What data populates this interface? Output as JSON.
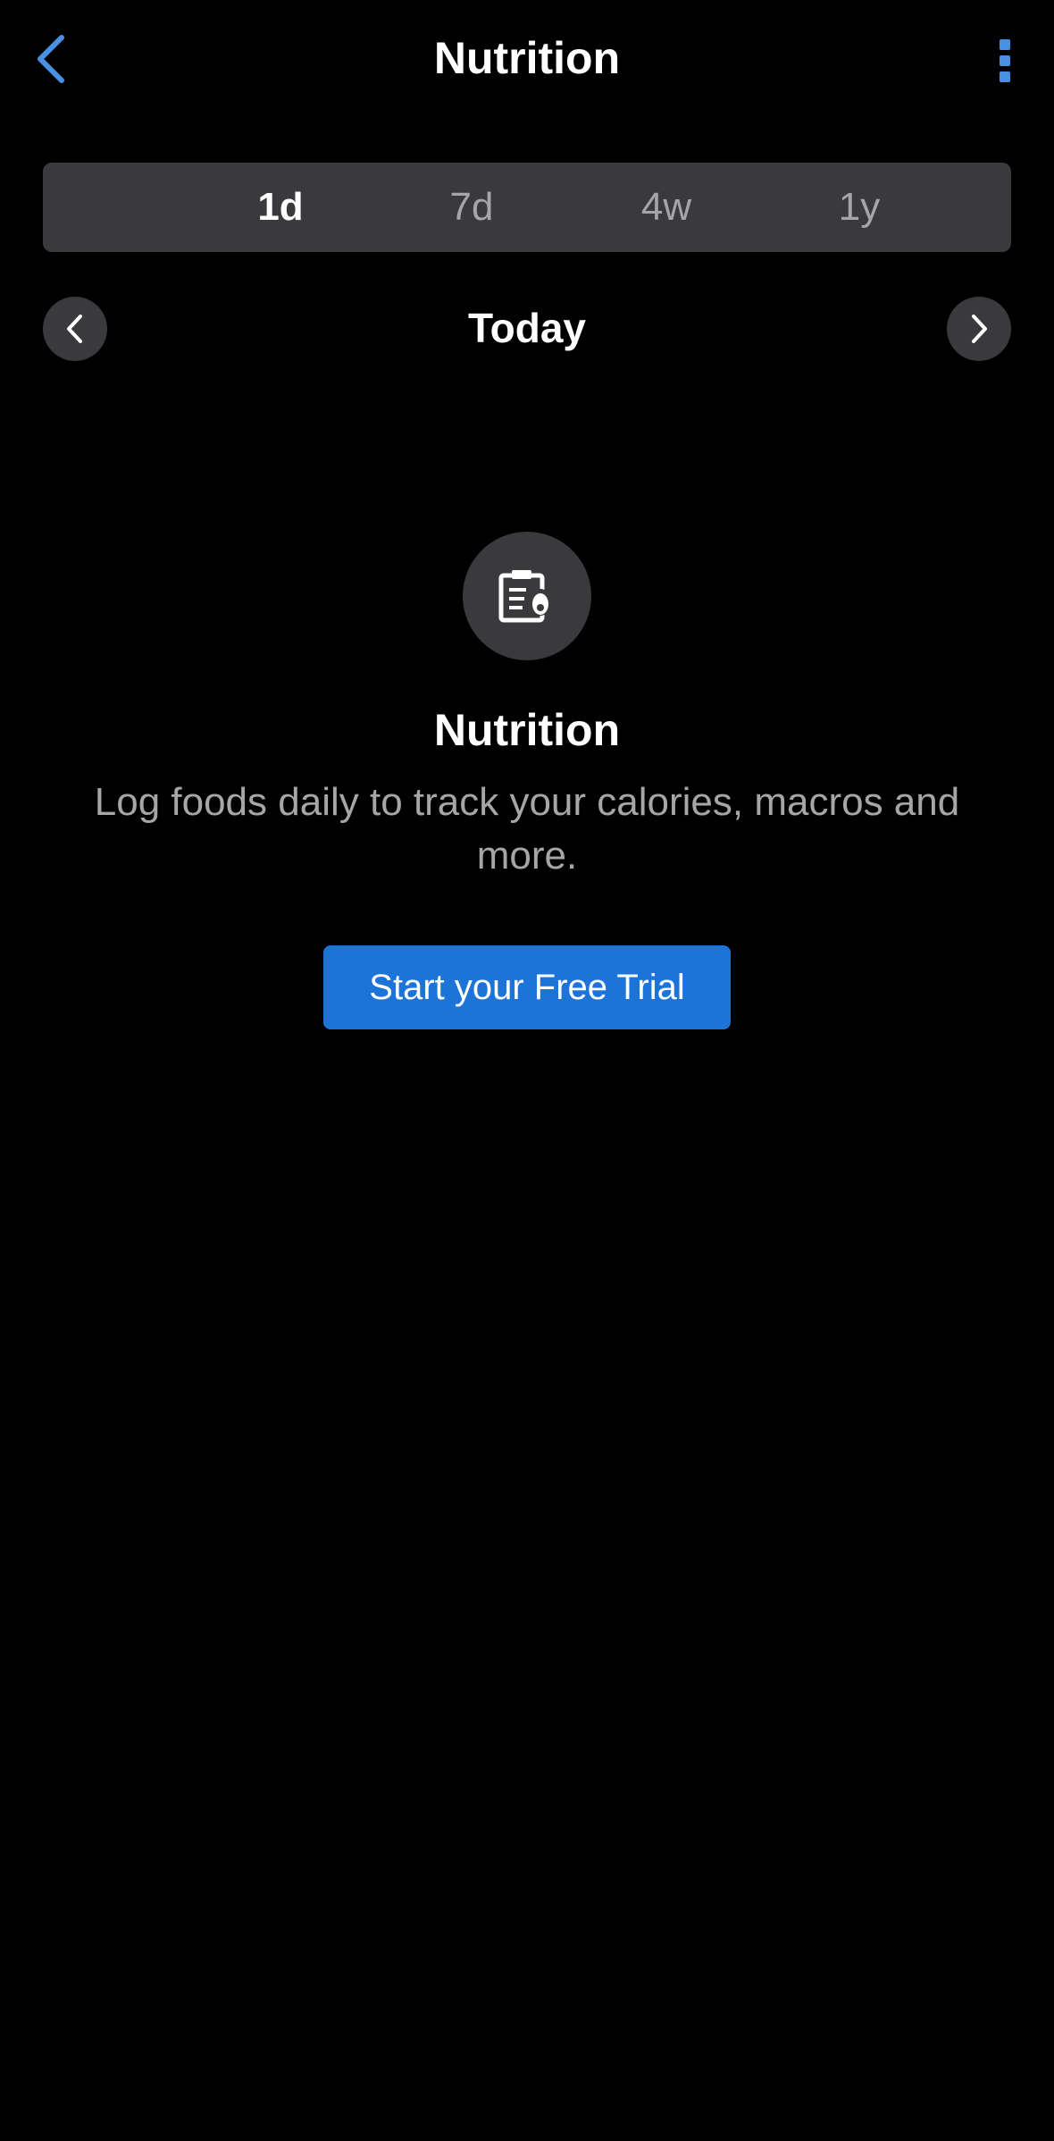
{
  "header": {
    "title": "Nutrition",
    "back_icon": "chevron-left-icon",
    "more_icon": "vertical-dots-icon"
  },
  "range_tabs": [
    {
      "label": "1d",
      "selected": true
    },
    {
      "label": "7d",
      "selected": false
    },
    {
      "label": "4w",
      "selected": false
    },
    {
      "label": "1y",
      "selected": false
    }
  ],
  "date_nav": {
    "label": "Today",
    "prev_icon": "chevron-left-icon",
    "next_icon": "chevron-right-icon"
  },
  "empty_state": {
    "icon": "clipboard-nutrition-icon",
    "title": "Nutrition",
    "description": "Log foods daily to track your calories, macros and more.",
    "cta_label": "Start your Free Trial"
  },
  "colors": {
    "background": "#000000",
    "accent": "#1c74d9",
    "control_bg": "#3a3a3c",
    "secondary_text": "#a6a6a8",
    "icon_accent": "#4a90e2"
  }
}
